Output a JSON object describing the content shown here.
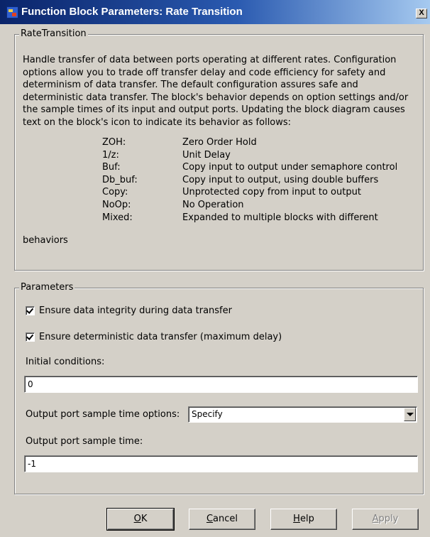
{
  "window": {
    "title": "Function Block Parameters: Rate Transition",
    "close_glyph": "X",
    "icon": "simulink-block-icon"
  },
  "rate_transition_group": {
    "legend": "RateTransition",
    "description": "Handle transfer of data between ports operating at different rates. Configuration options allow you to trade off transfer delay and code efficiency for safety and determinism of data transfer. The default configuration assures safe and deterministic data transfer. The block's behavior depends on option settings and/or the sample times of its input and output ports. Updating the block diagram causes text on the block's icon to indicate its behavior as follows:",
    "behaviors": [
      {
        "code": "ZOH:",
        "meaning": "Zero Order Hold"
      },
      {
        "code": "1/z:",
        "meaning": "Unit Delay"
      },
      {
        "code": "Buf:",
        "meaning": "Copy input to output under semaphore control"
      },
      {
        "code": "Db_buf:",
        "meaning": "Copy input to output, using double buffers"
      },
      {
        "code": "Copy:",
        "meaning": "Unprotected copy from input to output"
      },
      {
        "code": "NoOp:",
        "meaning": "No Operation"
      },
      {
        "code": "Mixed:",
        "meaning": "Expanded to multiple blocks with different"
      }
    ],
    "trailing": "behaviors"
  },
  "parameters_group": {
    "legend": "Parameters",
    "ensure_integrity": {
      "label": "Ensure data integrity during data transfer",
      "checked": true
    },
    "ensure_deterministic": {
      "label": "Ensure deterministic data transfer (maximum delay)",
      "checked": true
    },
    "initial_conditions": {
      "label": "Initial conditions:",
      "value": "0"
    },
    "output_port_options": {
      "label": "Output port sample time options:",
      "selected": "Specify"
    },
    "output_port_sample_time": {
      "label": "Output port sample time:",
      "value": "-1"
    }
  },
  "buttons": {
    "ok": {
      "pre": "",
      "mnemonic": "O",
      "post": "K"
    },
    "cancel": {
      "pre": "",
      "mnemonic": "C",
      "post": "ancel"
    },
    "help": {
      "pre": "",
      "mnemonic": "H",
      "post": "elp"
    },
    "apply": {
      "pre": "",
      "mnemonic": "A",
      "post": "pply",
      "enabled": false
    }
  },
  "colors": {
    "dialog_bg": "#d4d0c8",
    "titlebar_start": "#0a246a",
    "titlebar_end": "#a6caf0"
  }
}
